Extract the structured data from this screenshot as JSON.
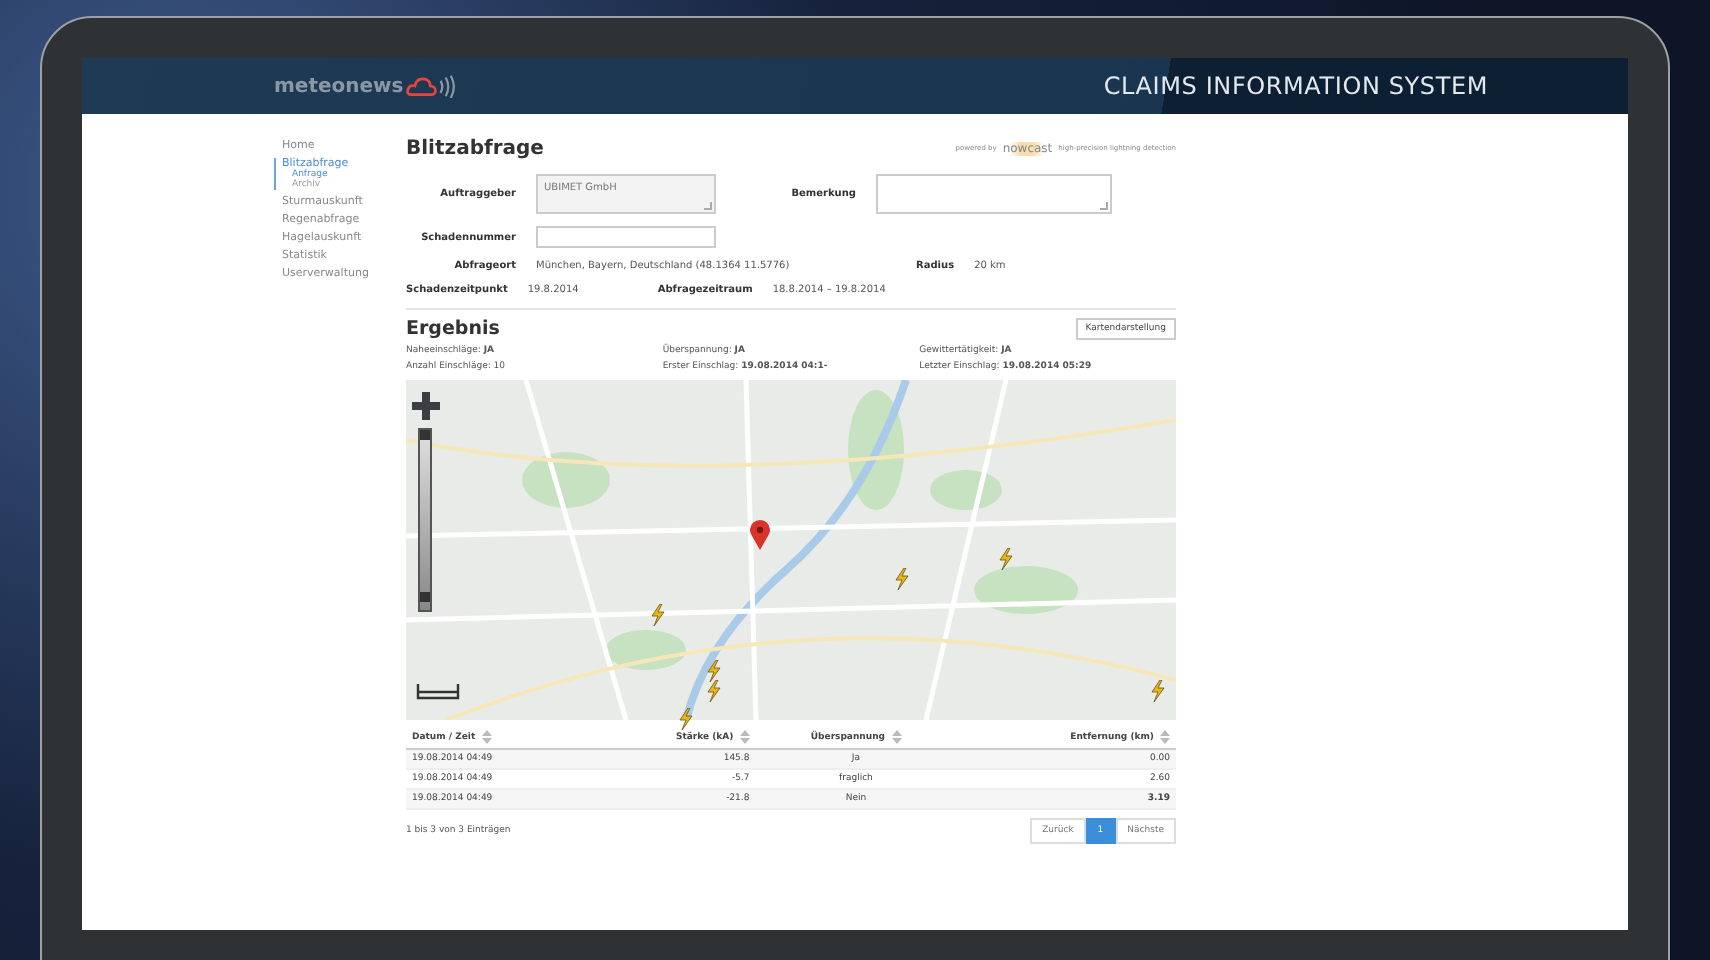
{
  "header": {
    "logo": "meteonews",
    "title": "CLAIMS INFORMATION SYSTEM"
  },
  "sidebar": {
    "items": [
      {
        "label": "Home",
        "selected": false
      },
      {
        "label": "Blitzabfrage",
        "selected": true,
        "children": [
          {
            "label": "Anfrage",
            "selected": true
          },
          {
            "label": "Archiv",
            "selected": false
          }
        ]
      },
      {
        "label": "Sturmauskunft",
        "selected": false
      },
      {
        "label": "Regenabfrage",
        "selected": false
      },
      {
        "label": "Hagelauskunft",
        "selected": false
      },
      {
        "label": "Statistik",
        "selected": false
      },
      {
        "label": "Userverwaltung",
        "selected": false
      }
    ]
  },
  "page_title": "Blitzabfrage",
  "powered_by": {
    "label": "powered by",
    "brand": "nowcast",
    "tagline": "high-precision lightning detection"
  },
  "form": {
    "auftraggeber": {
      "label": "Auftraggeber",
      "value": "UBIMET GmbH"
    },
    "bemerkung": {
      "label": "Bemerkung"
    },
    "schadennummer": {
      "label": "Schadennummer"
    },
    "abfrageort": {
      "label": "Abfrageort",
      "value": "München, Bayern, Deutschland (48.1364 11.5776)"
    },
    "radius": {
      "label": "Radius",
      "value": "20 km"
    },
    "schadenzeitpunkt": {
      "label": "Schadenzeitpunkt",
      "value": "19.8.2014"
    },
    "abfragezeitraum": {
      "label": "Abfragezeitraum",
      "value": "18.8.2014 – 19.8.2014"
    }
  },
  "result": {
    "title": "Ergebnis",
    "map_button": "Kartendarstellung",
    "stats": [
      "Naheeinschläge: **JA**",
      "Überspannung: **JA**",
      "Gewittertätigkeit: **JA**",
      "Anzahl Einschläge: 10",
      "Erster Einschlag: **19.08.2014 04:1-**",
      "Letzter Einschlag: **19.08.2014 05:29**"
    ]
  },
  "map": {
    "zoom": {
      "level": 0.05
    }
  },
  "table": {
    "columns": [
      "Datum / Zeit",
      "Stärke (kA)",
      "Überspannung",
      "Entfernung (km)"
    ],
    "rows": [
      {
        "cells": [
          "19.08.2014 04:49",
          "145.8",
          "Ja",
          "0.00"
        ],
        "emphasis": false
      },
      {
        "cells": [
          "19.08.2014 04:49",
          "-5.7",
          "fraglich",
          "2.60"
        ],
        "emphasis": false
      },
      {
        "cells": [
          "19.08.2014 04:49",
          "-21.8",
          "Nein",
          "3.19"
        ],
        "emphasis": true
      }
    ]
  },
  "pagination": {
    "info": "1 bis 3 von 3 Einträgen",
    "prev": "Zurück",
    "pages": [
      {
        "label": "1",
        "selected": true
      }
    ],
    "next": "Nächste"
  }
}
